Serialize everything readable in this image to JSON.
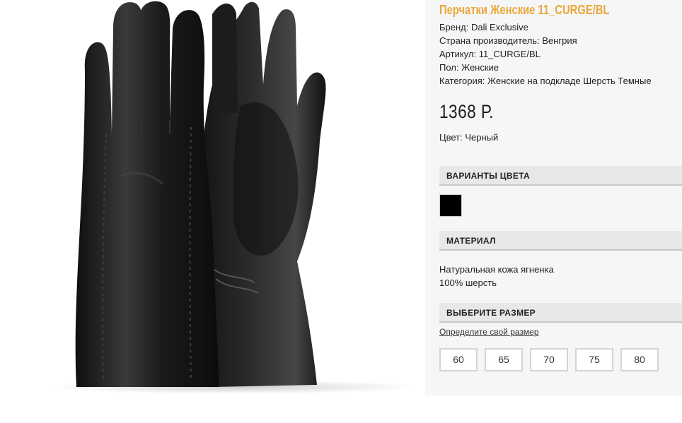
{
  "product": {
    "title": "Перчатки Женские 11_CURGE/BL",
    "brand": "Бренд: Dali Exclusive",
    "country": "Страна производитель: Венгрия",
    "sku": "Артикул: 11_CURGE/BL",
    "gender": "Пол: Женские",
    "category": "Категория: Женские на подкладе Шерсть Темные",
    "price": "1368 Р.",
    "color": "Цвет: Черный",
    "title_color": "#e9a83a"
  },
  "color_variants": {
    "heading": "ВАРИАНТЫ ЦВЕТА",
    "swatches": [
      {
        "hex": "#000000"
      }
    ]
  },
  "material": {
    "heading": "МАТЕРИАЛ",
    "lines": [
      "Натуральная кожа ягненка",
      "100% шерсть"
    ]
  },
  "sizes": {
    "heading": "ВЫБЕРИТЕ РАЗМЕР",
    "guide_link": "Определите свой размер",
    "options": [
      "60",
      "65",
      "70",
      "75",
      "80"
    ]
  },
  "image": {
    "icon": "gloves-product-photo"
  }
}
